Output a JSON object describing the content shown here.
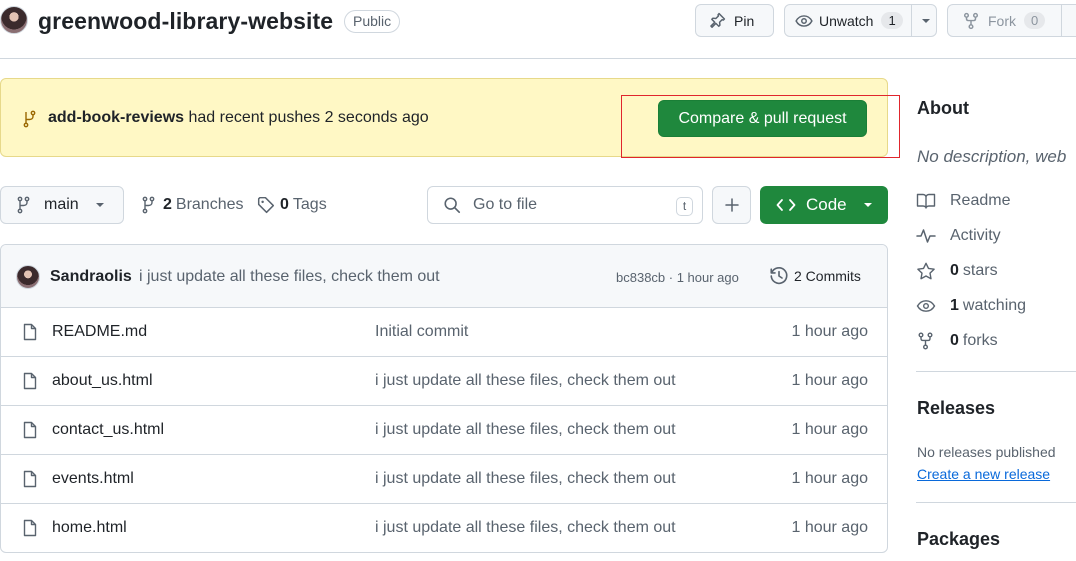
{
  "repo": {
    "name": "greenwood-library-website",
    "visibility": "Public"
  },
  "header_actions": {
    "pin_label": "Pin",
    "unwatch_label": "Unwatch",
    "unwatch_count": "1",
    "fork_label": "Fork",
    "fork_count": "0"
  },
  "banner": {
    "branch": "add-book-reviews",
    "text": "had recent pushes 2 seconds ago",
    "button_label": "Compare & pull request"
  },
  "toolbar": {
    "branch": "main",
    "branches_count": "2",
    "branches_label": "Branches",
    "tags_count": "0",
    "tags_label": "Tags",
    "goto_placeholder": "Go to file",
    "goto_shortcut": "t",
    "code_label": "Code"
  },
  "latest_commit": {
    "author": "Sandraolis",
    "message": "i just update all these files, check them out",
    "sha_time": "bc838cb · 1 hour ago",
    "commits_label": "2 Commits"
  },
  "files": [
    {
      "name": "README.md",
      "message": "Initial commit",
      "time": "1 hour ago"
    },
    {
      "name": "about_us.html",
      "message": "i just update all these files, check them out",
      "time": "1 hour ago"
    },
    {
      "name": "contact_us.html",
      "message": "i just update all these files, check them out",
      "time": "1 hour ago"
    },
    {
      "name": "events.html",
      "message": "i just update all these files, check them out",
      "time": "1 hour ago"
    },
    {
      "name": "home.html",
      "message": "i just update all these files, check them out",
      "time": "1 hour ago"
    }
  ],
  "sidebar": {
    "about_title": "About",
    "description": "No description, web",
    "readme": "Readme",
    "activity": "Activity",
    "stars_count": "0",
    "stars_label": "stars",
    "watching_count": "1",
    "watching_label": "watching",
    "forks_count": "0",
    "forks_label": "forks",
    "releases_title": "Releases",
    "no_releases": "No releases published",
    "create_release": "Create a new release",
    "packages_title": "Packages"
  },
  "colors": {
    "primary_button": "#1f883d",
    "banner_bg": "#fff8c5",
    "highlight_box": "#e0262d",
    "link": "#0969da"
  }
}
